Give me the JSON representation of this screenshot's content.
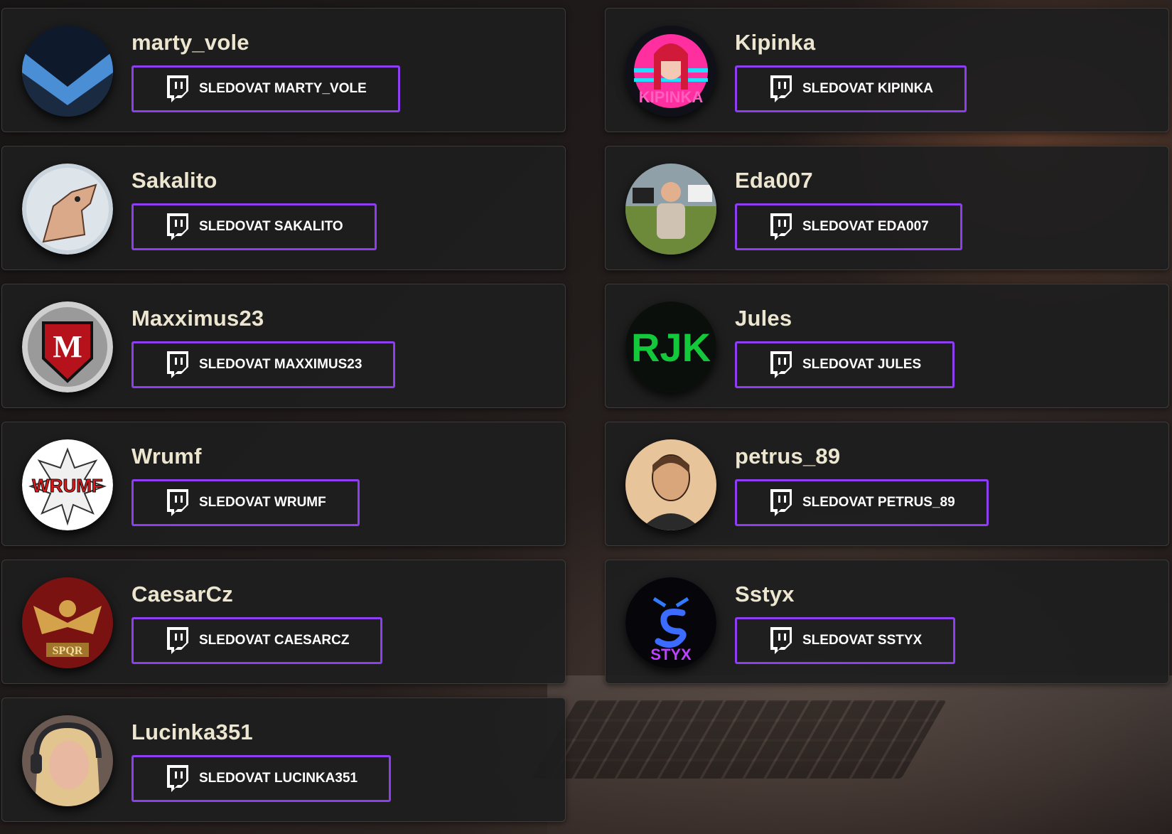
{
  "streamers": [
    {
      "name": "marty_vole",
      "button_label": "SLEDOVAT MARTY_VOLE",
      "avatar": "m-chevron-logo",
      "colors": [
        "#0e1b2e",
        "#4a8fd6"
      ]
    },
    {
      "name": "Kipinka",
      "button_label": "SLEDOVAT KIPINKA",
      "avatar": "anime-girl-kipinka-logo",
      "colors": [
        "#ff2fa0",
        "#21e0ff"
      ]
    },
    {
      "name": "Sakalito",
      "button_label": "SLEDOVAT SAKALITO",
      "avatar": "howling-jackal-logo",
      "colors": [
        "#c9d3dc",
        "#d9a98a"
      ]
    },
    {
      "name": "Eda007",
      "button_label": "SLEDOVAT EDA007",
      "avatar": "man-with-cows-photo",
      "colors": [
        "#6c8a3a",
        "#cfc2b3"
      ]
    },
    {
      "name": "Maxximus23",
      "button_label": "SLEDOVAT MAXXIMUS23",
      "avatar": "maxximus-shield-logo",
      "colors": [
        "#b5121b",
        "#d5d5d5"
      ]
    },
    {
      "name": "Jules",
      "button_label": "SLEDOVAT JULES",
      "avatar": "rjk-green-logo",
      "colors": [
        "#14ff3c",
        "#0b0f0b"
      ]
    },
    {
      "name": "Wrumf",
      "button_label": "SLEDOVAT WRUMF",
      "avatar": "wrumf-comic-logo",
      "colors": [
        "#e01818",
        "#ffffff"
      ]
    },
    {
      "name": "petrus_89",
      "button_label": "SLEDOVAT PETRUS_89",
      "avatar": "cartoon-man-portrait",
      "colors": [
        "#e8c49a",
        "#2a2a2a"
      ]
    },
    {
      "name": "CaesarCz",
      "button_label": "SLEDOVAT CAESARCZ",
      "avatar": "spqr-eagle-logo",
      "colors": [
        "#7a1212",
        "#d4a24a"
      ]
    },
    {
      "name": "Sstyx",
      "button_label": "SLEDOVAT SSTYX",
      "avatar": "styx-serpent-logo",
      "colors": [
        "#2f7bff",
        "#c040ff"
      ]
    },
    {
      "name": "Lucinka351",
      "button_label": "SLEDOVAT LUCINKA351",
      "avatar": "woman-headphones-photo",
      "colors": [
        "#c79b80",
        "#3d3a3a"
      ]
    }
  ],
  "accent_color": "#8c3ff0",
  "button_icon": "twitch-icon"
}
